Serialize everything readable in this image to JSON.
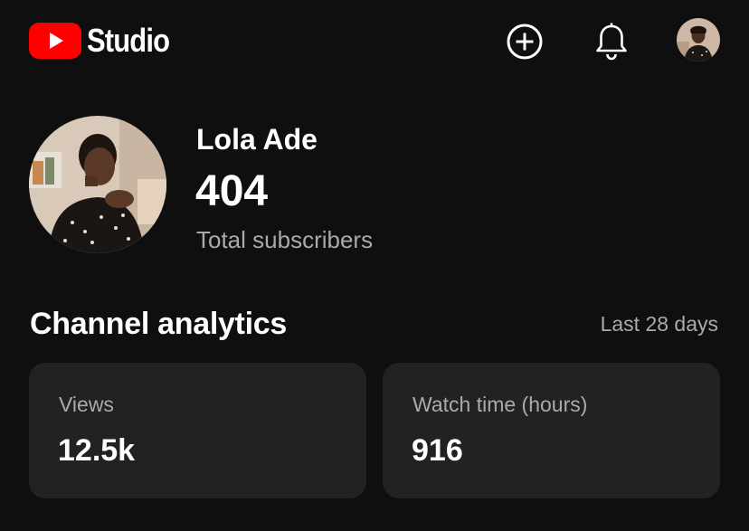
{
  "header": {
    "logo_text": "Studio",
    "brand_color": "#ff0000",
    "create_icon": "plus-circle-icon",
    "notifications_icon": "bell-icon"
  },
  "channel": {
    "name": "Lola Ade",
    "subscriber_count": "404",
    "subscriber_label": "Total subscribers"
  },
  "analytics": {
    "title": "Channel analytics",
    "period": "Last 28 days",
    "cards": [
      {
        "label": "Views",
        "value": "12.5k"
      },
      {
        "label": "Watch time (hours)",
        "value": "916"
      }
    ]
  }
}
